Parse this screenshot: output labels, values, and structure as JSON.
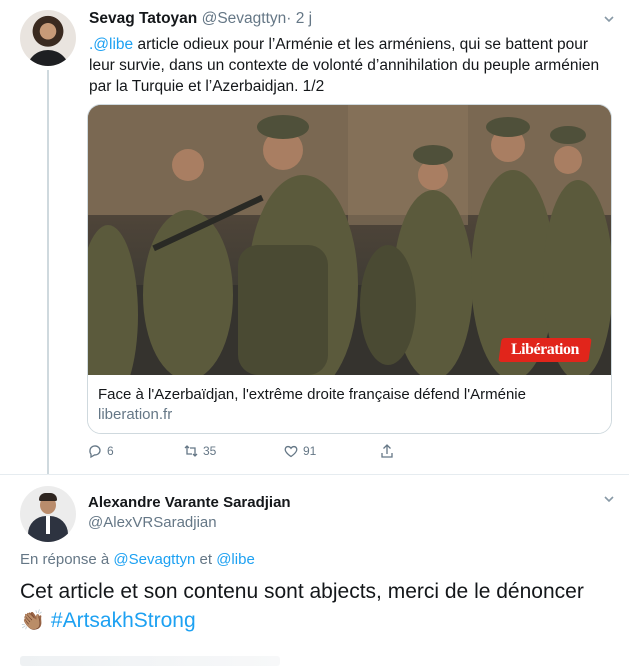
{
  "tweet1": {
    "name": "Sevag Tatoyan",
    "handle": "@Sevagttyn",
    "time": "· 2 j",
    "mention": ".@libe",
    "text": " article odieux pour l’Arménie et les arméniens, qui se battent pour leur survie, dans un contexte de volonté d’annihilation du peuple arménien par la Turquie et l’Azerbaidjan. 1/2",
    "card": {
      "logo_text": "Libération",
      "title": "Face à l'Azerbaïdjan, l'extrême droite française défend l'Arménie",
      "domain": "liberation.fr"
    },
    "actions": {
      "replies": "6",
      "retweets": "35",
      "likes": "91"
    }
  },
  "tweet2": {
    "name": "Alexandre Varante Saradjian",
    "handle": "@AlexVRSaradjian",
    "reply_prefix": "En réponse à ",
    "reply_mention1": "@Sevagttyn",
    "reply_and": " et ",
    "reply_mention2": "@libe",
    "text": "Cet article et son contenu sont abjects, merci de le dénoncer",
    "emoji": "👏🏽",
    "hashtag": "#ArtsakhStrong"
  },
  "icons": [
    "chevron-down-icon",
    "reply-icon",
    "retweet-icon",
    "like-icon",
    "share-icon"
  ],
  "colors": {
    "accent": "#1da1f2",
    "muted": "#657786",
    "logo_red": "#e1251b"
  }
}
